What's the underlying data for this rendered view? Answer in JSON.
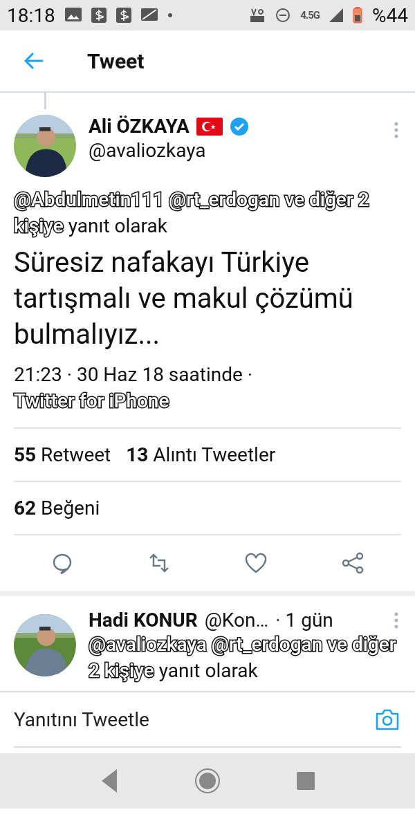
{
  "status_bar": {
    "time": "18:18",
    "network": "4.5G",
    "battery": "%44"
  },
  "header": {
    "title": "Tweet"
  },
  "tweet": {
    "author": "Ali ÖZKAYA",
    "handle": "@avaliozkaya",
    "reply_to": {
      "mentions": "@Abdulmetin111 @rt_erdogan ve diğer 2 kişiye",
      "suffix": "yanıt olarak"
    },
    "text": "Süresiz nafakayı Türkiye tartışmalı ve makul çözümü bulmalıyız...",
    "timestamp": "21:23 · 30 Haz 18 saatinde ·",
    "source": "Twitter for iPhone",
    "stats": [
      {
        "count": "55",
        "label": "Retweet"
      },
      {
        "count": "13",
        "label": "Alıntı Tweetler"
      }
    ],
    "likes": {
      "count": "62",
      "label": "Beğeni"
    }
  },
  "reply": {
    "author": "Hadi KONUR",
    "handle": "@Kon…",
    "time": "· 1 gün",
    "reply_to": {
      "mentions": "@avaliozkaya @rt_erdogan ve diğer 2 kişiye",
      "suffix": "yanıt olarak"
    }
  },
  "compose": {
    "placeholder": "Yanıtını Tweetle"
  }
}
